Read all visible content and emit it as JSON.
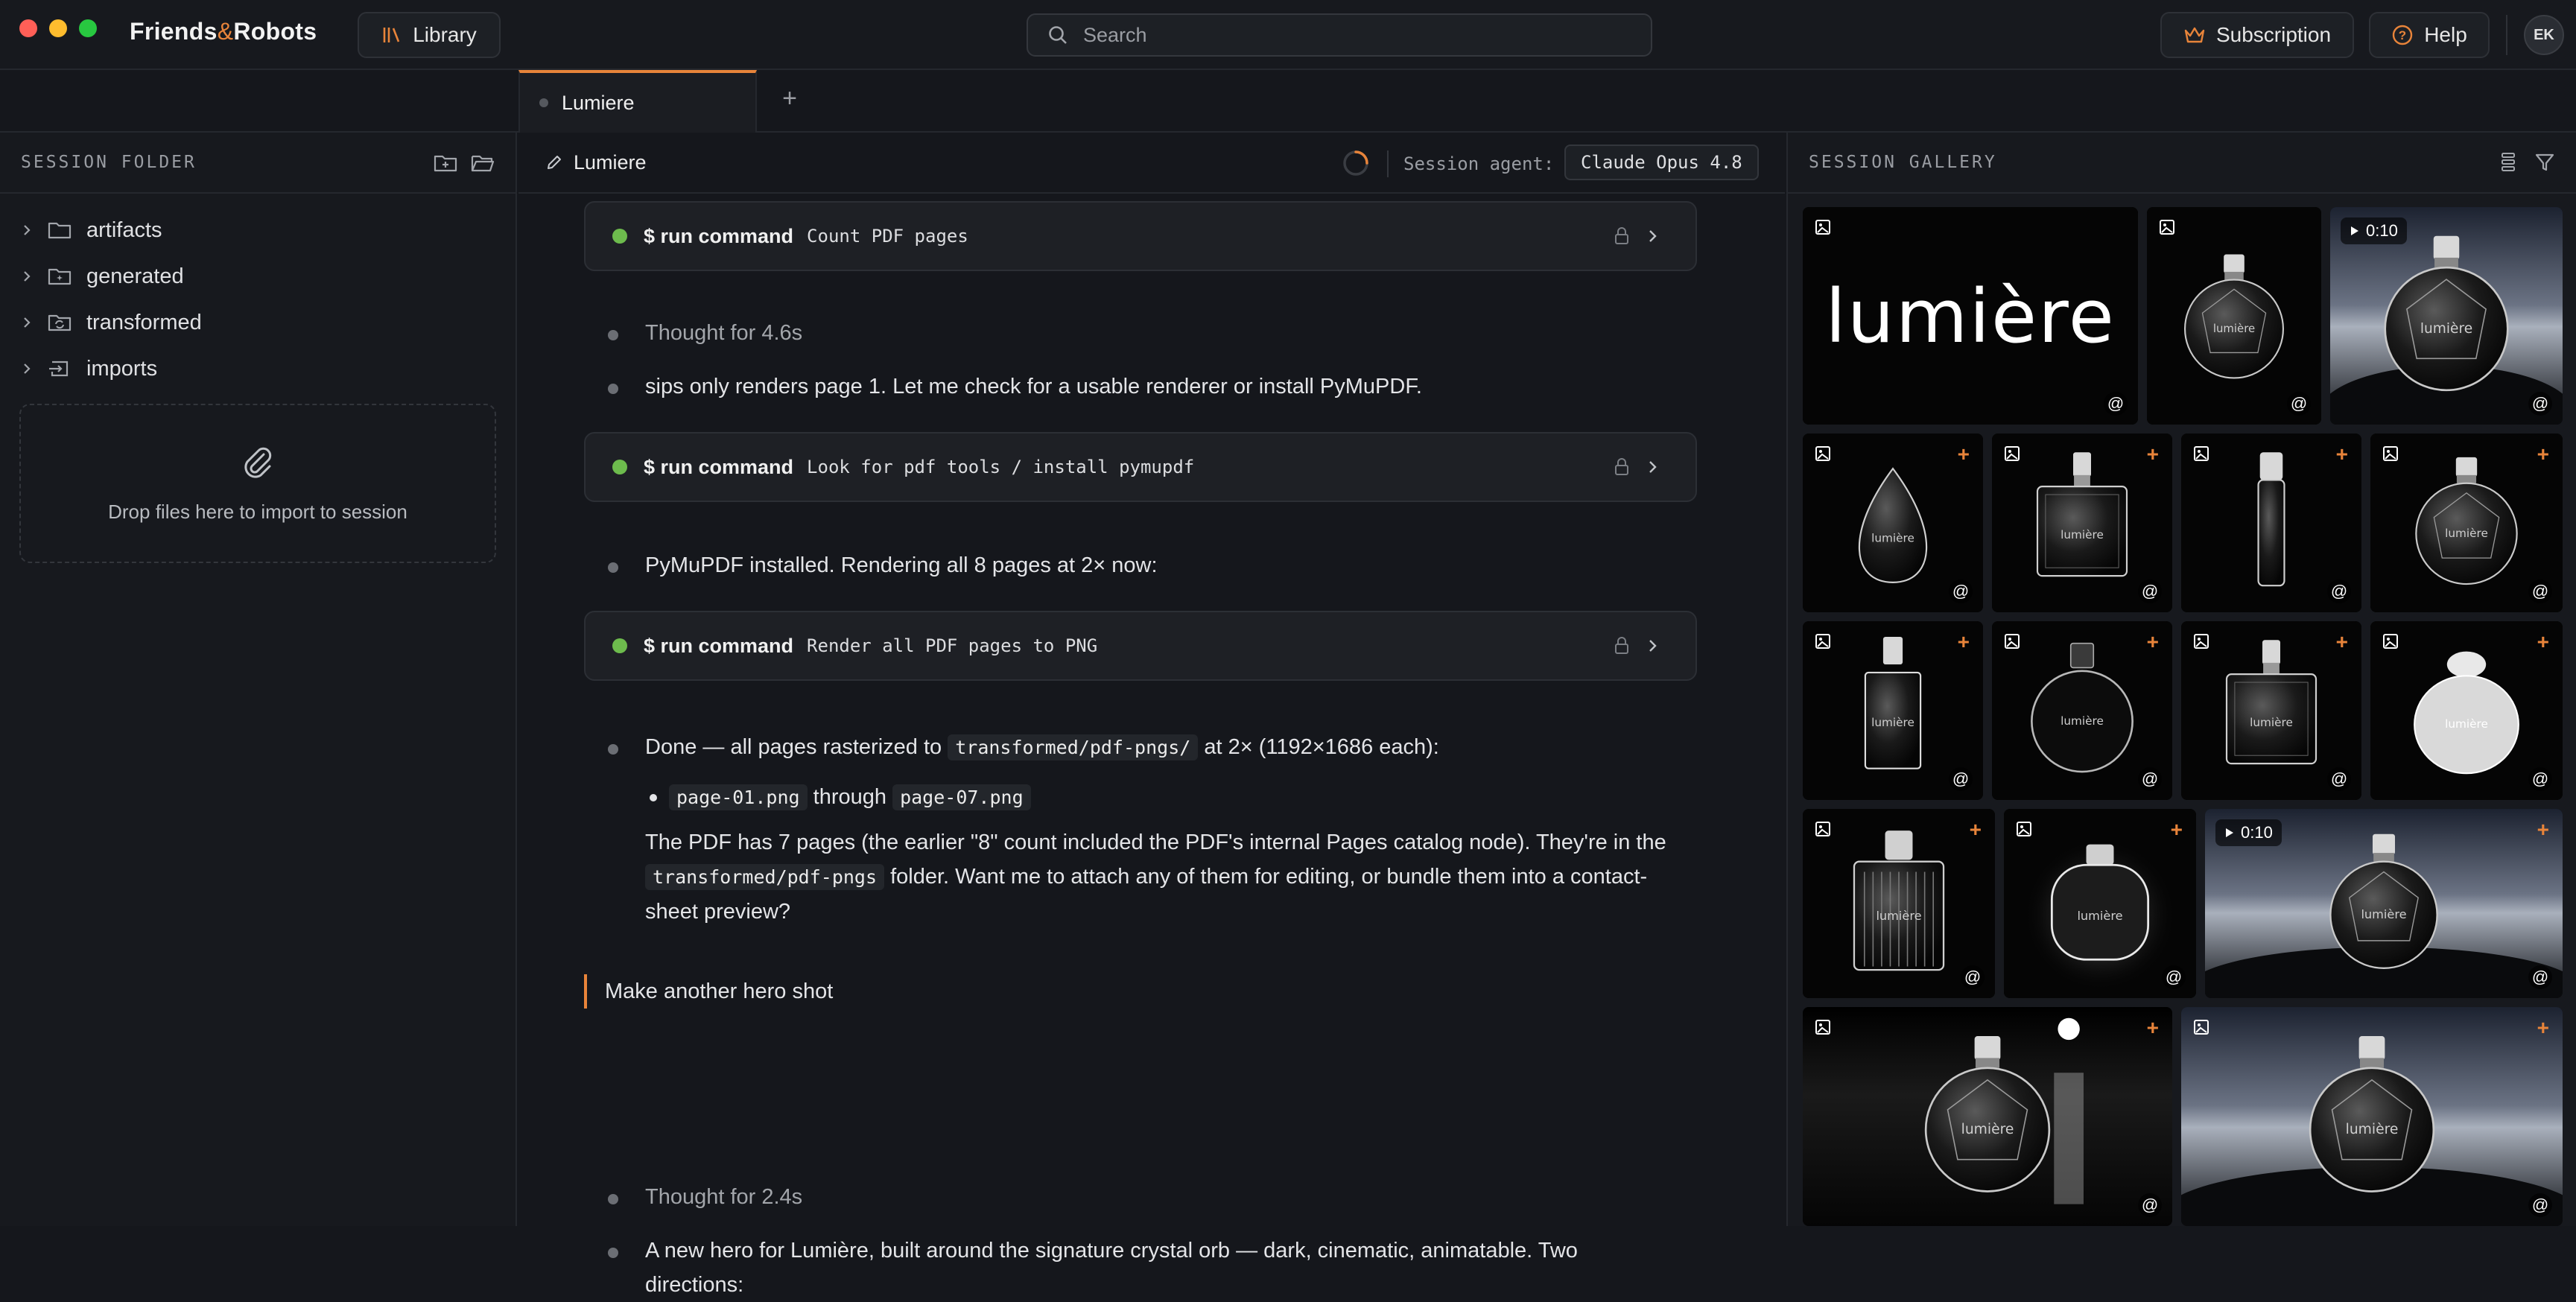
{
  "app": {
    "logo_left": "Friends",
    "logo_amp": "&",
    "logo_right": "Robots",
    "library_label": "Library",
    "search_placeholder": "Search",
    "subscription_label": "Subscription",
    "help_label": "Help",
    "avatar_initials": "EK"
  },
  "tabs": {
    "active_label": "Lumiere",
    "add_label": "+"
  },
  "left_panel": {
    "title": "SESSION FOLDER",
    "folders": [
      "artifacts",
      "generated",
      "transformed",
      "imports"
    ],
    "drop_text": "Drop files here to import to session"
  },
  "center": {
    "session_title": "Lumiere",
    "agent_label": "Session agent:",
    "agent_value": "Claude Opus 4.8",
    "commands": [
      {
        "key": "$ run command",
        "value": "Count PDF pages"
      },
      {
        "key": "$ run command",
        "value": "Look for pdf tools / install pymupdf"
      },
      {
        "key": "$ run command",
        "value": "Render all PDF pages to PNG"
      }
    ],
    "thought_1": "Thought for 4.6s",
    "msg_sips": "sips only renders page 1. Let me check for a usable renderer or install PyMuPDF.",
    "msg_installed": "PyMuPDF installed. Rendering all 8 pages at 2× now:",
    "done_prefix": "Done — all pages rasterized to",
    "done_path": "transformed/pdf-pngs/",
    "done_suffix": "at 2× (1192×1686 each):",
    "bullet_from": "page-01.png",
    "bullet_through": "through",
    "bullet_to": "page-07.png",
    "pages_text_1": "The PDF has 7 pages (the earlier \"8\" count included the PDF's internal Pages catalog node). They're in the",
    "pages_path": "transformed/pdf-pngs",
    "pages_text_2": "folder. Want me to attach any of them for editing, or bundle them into a contact-sheet preview?",
    "user_message": "Make another hero shot",
    "thought_2": "Thought for 2.4s",
    "hero_text": "A new hero for Lumière, built around the signature crystal orb — dark, cinematic, animatable. Two directions:"
  },
  "right_panel": {
    "title": "SESSION GALLERY",
    "wordmark": "lumière",
    "bottle_label": "lumière",
    "video_duration": "0:10",
    "at_symbol": "@",
    "plus_symbol": "+"
  },
  "colors": {
    "accent": "#e8843a",
    "status_green": "#6dbb4d",
    "background": "#15171c"
  }
}
